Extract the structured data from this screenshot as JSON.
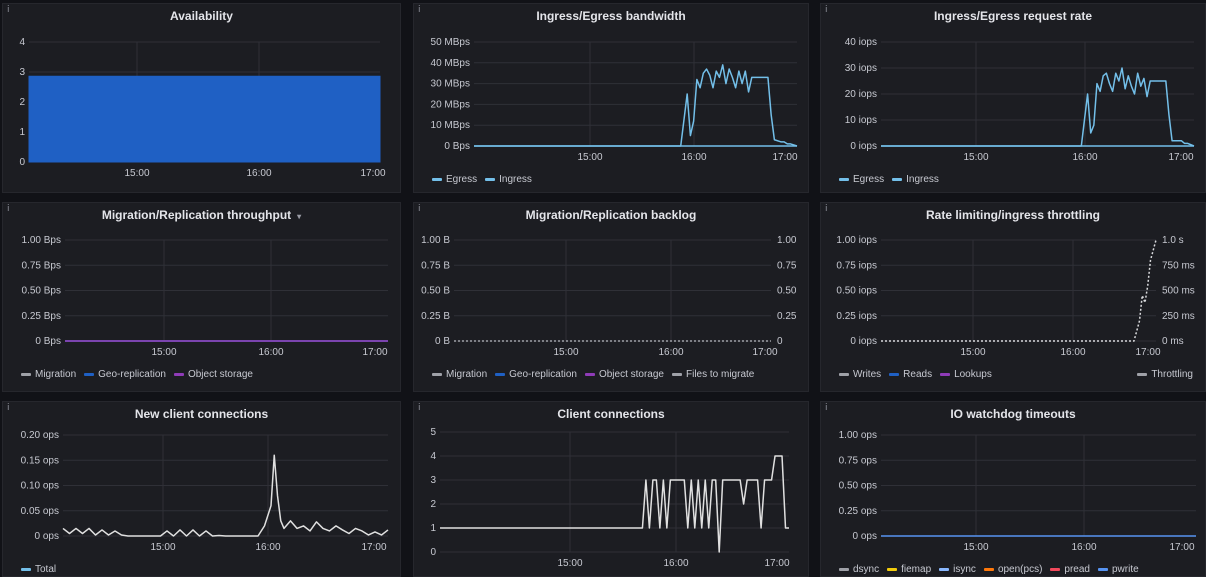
{
  "colors": {
    "background": "#111217",
    "panel": "#1c1d22",
    "grid": "#2f3037",
    "blue_area": "#1f60c4",
    "light_blue": "#73bfe9",
    "dark_blue": "#1f60c4",
    "purple": "#8f3bb8",
    "gray": "#9fa1a8",
    "white": "#e0e0e0",
    "yellow": "#f2cc0c",
    "cyan": "#8ab8ff",
    "orange": "#ff780a",
    "red": "#f2495c"
  },
  "panels": [
    {
      "title": "Availability",
      "chart_data": {
        "type": "area",
        "title": "Availability",
        "yticks": [
          "4",
          "3",
          "2",
          "1",
          "0"
        ],
        "ylim": [
          0,
          4.2
        ],
        "xticks": [
          "15:00",
          "16:00",
          "17:00"
        ],
        "series": [
          {
            "color": "#1f60c4",
            "x": [
              0,
              100
            ],
            "y": [
              3,
              3
            ]
          }
        ]
      }
    },
    {
      "title": "Ingress/Egress bandwidth",
      "legend": [
        {
          "label": "Egress",
          "color": "#73bfe9"
        },
        {
          "label": "Ingress",
          "color": "#73bfe9"
        }
      ],
      "chart_data": {
        "type": "line",
        "title": "Ingress/Egress bandwidth",
        "yticks": [
          "50 MBps",
          "40 MBps",
          "30 MBps",
          "20 MBps",
          "10 MBps",
          "0 Bps"
        ],
        "ylim": [
          0,
          50
        ],
        "xticks": [
          "15:00",
          "16:00",
          "17:00"
        ],
        "series": [
          {
            "name": "Egress",
            "color": "#73bfe9",
            "x": [
              0,
              100
            ],
            "y": [
              0,
              0
            ]
          },
          {
            "name": "Ingress",
            "color": "#73bfe9",
            "x": [
              0,
              64,
              66,
              67,
              68,
              69,
              70,
              71,
              72,
              73,
              74,
              75,
              76,
              77,
              78,
              79,
              80,
              81,
              82,
              83,
              84,
              85,
              86,
              87,
              88,
              89,
              90,
              91,
              92,
              93,
              95,
              96,
              97,
              98,
              100
            ],
            "y": [
              0,
              0,
              25,
              5,
              12,
              32,
              28,
              35,
              37,
              34,
              28,
              36,
              33,
              39,
              30,
              37,
              33,
              28,
              36,
              30,
              36,
              26,
              33,
              33,
              33,
              33,
              33,
              33,
              15,
              3,
              2,
              2,
              1,
              1,
              0
            ]
          }
        ]
      }
    },
    {
      "title": "Ingress/Egress request rate",
      "legend": [
        {
          "label": "Egress",
          "color": "#73bfe9"
        },
        {
          "label": "Ingress",
          "color": "#73bfe9"
        }
      ],
      "chart_data": {
        "type": "line",
        "title": "Ingress/Egress request rate",
        "yticks": [
          "40 iops",
          "30 iops",
          "20 iops",
          "10 iops",
          "0 iops"
        ],
        "ylim": [
          0,
          40
        ],
        "xticks": [
          "15:00",
          "16:00",
          "17:00"
        ],
        "series": [
          {
            "name": "Egress",
            "color": "#73bfe9",
            "x": [
              0,
              100
            ],
            "y": [
              0,
              0
            ]
          },
          {
            "name": "Ingress",
            "color": "#73bfe9",
            "x": [
              0,
              64,
              66,
              67,
              68,
              69,
              70,
              71,
              72,
              73,
              74,
              75,
              76,
              77,
              78,
              79,
              80,
              81,
              82,
              83,
              84,
              85,
              86,
              87,
              88,
              89,
              90,
              91,
              92,
              93,
              95,
              96,
              97,
              98,
              100
            ],
            "y": [
              0,
              0,
              20,
              5,
              8,
              24,
              21,
              27,
              28,
              24,
              21,
              28,
              25,
              30,
              22,
              27,
              23,
              20,
              28,
              23,
              26,
              19,
              25,
              25,
              25,
              25,
              25,
              25,
              12,
              2,
              2,
              2,
              1,
              1,
              0
            ]
          }
        ]
      }
    },
    {
      "title": "Migration/Replication throughput",
      "dropdown": "▾",
      "legend": [
        {
          "label": "Migration",
          "color": "#9fa1a8"
        },
        {
          "label": "Geo-replication",
          "color": "#1f60c4"
        },
        {
          "label": "Object storage",
          "color": "#8f3bb8"
        }
      ],
      "chart_data": {
        "type": "line",
        "title": "Migration/Replication throughput",
        "yticks": [
          "1.00 Bps",
          "0.75 Bps",
          "0.50 Bps",
          "0.25 Bps",
          "0 Bps"
        ],
        "ylim": [
          0,
          1
        ],
        "xticks": [
          "15:00",
          "16:00",
          "17:00"
        ],
        "series": [
          {
            "name": "Migration",
            "color": "#9fa1a8",
            "x": [
              0,
              100
            ],
            "y": [
              0,
              0
            ]
          },
          {
            "name": "Geo-replication",
            "color": "#1f60c4",
            "x": [
              0,
              100
            ],
            "y": [
              0,
              0
            ]
          },
          {
            "name": "Object storage",
            "color": "#8f3bb8",
            "x": [
              0,
              100
            ],
            "y": [
              0,
              0
            ]
          }
        ]
      }
    },
    {
      "title": "Migration/Replication backlog",
      "legend": [
        {
          "label": "Migration",
          "color": "#9fa1a8"
        },
        {
          "label": "Geo-replication",
          "color": "#1f60c4"
        },
        {
          "label": "Object storage",
          "color": "#8f3bb8"
        },
        {
          "label": "Files to migrate",
          "color": "#9fa1a8"
        }
      ],
      "chart_data": {
        "type": "line",
        "title": "Migration/Replication backlog",
        "yticks": [
          "1.00 B",
          "0.75 B",
          "0.50 B",
          "0.25 B",
          "0 B"
        ],
        "yticks_right": [
          "1.00",
          "0.75",
          "0.50",
          "0.25",
          "0"
        ],
        "ylim": [
          0,
          1
        ],
        "xticks": [
          "15:00",
          "16:00",
          "17:00"
        ],
        "series": [
          {
            "name": "Files to migrate",
            "color": "#9fa1a8",
            "dashed": true,
            "x": [
              0,
              100
            ],
            "y": [
              0,
              0
            ]
          }
        ]
      }
    },
    {
      "title": "Rate limiting/ingress throttling",
      "legend": [
        {
          "label": "Writes",
          "color": "#9fa1a8"
        },
        {
          "label": "Reads",
          "color": "#1f60c4"
        },
        {
          "label": "Lookups",
          "color": "#8f3bb8"
        }
      ],
      "legend_right": [
        {
          "label": "Throttling",
          "color": "#9fa1a8"
        }
      ],
      "chart_data": {
        "type": "line",
        "title": "Rate limiting/ingress throttling",
        "yticks": [
          "1.00 iops",
          "0.75 iops",
          "0.50 iops",
          "0.25 iops",
          "0 iops"
        ],
        "yticks_right": [
          "1.0 s",
          "750 ms",
          "500 ms",
          "250 ms",
          "0 ms"
        ],
        "ylim": [
          0,
          1
        ],
        "xticks": [
          "15:00",
          "16:00",
          "17:00"
        ],
        "series": [
          {
            "name": "Throttling",
            "color": "#d8d9dc",
            "dashed": true,
            "x": [
              0,
              92,
              94,
              95,
              96,
              97,
              98,
              100
            ],
            "y": [
              0,
              0,
              0.2,
              0.45,
              0.38,
              0.55,
              0.8,
              1.0
            ]
          }
        ]
      }
    },
    {
      "title": "New client connections",
      "legend": [
        {
          "label": "Total",
          "color": "#73bfe9"
        }
      ],
      "chart_data": {
        "type": "line",
        "title": "New client connections",
        "yticks": [
          "0.20 ops",
          "0.15 ops",
          "0.10 ops",
          "0.05 ops",
          "0 ops"
        ],
        "ylim": [
          0,
          0.2
        ],
        "xticks": [
          "15:00",
          "16:00",
          "17:00"
        ],
        "series": [
          {
            "name": "Total",
            "color": "#e0e0e0",
            "x": [
              0,
              2,
              4,
              6,
              8,
              10,
              12,
              14,
              16,
              18,
              20,
              30,
              32,
              34,
              36,
              38,
              40,
              42,
              44,
              46,
              48,
              50,
              60,
              62,
              64,
              65,
              66,
              67,
              68,
              70,
              72,
              74,
              76,
              78,
              80,
              82,
              84,
              86,
              88,
              90,
              92,
              94,
              96,
              98,
              100
            ],
            "y": [
              0.015,
              0.005,
              0.015,
              0.005,
              0.015,
              0.002,
              0.012,
              0.002,
              0.01,
              0.002,
              0,
              0,
              0.01,
              0,
              0.012,
              0,
              0.012,
              0,
              0.01,
              0,
              0.001,
              0,
              0,
              0.02,
              0.06,
              0.16,
              0.08,
              0.03,
              0.015,
              0.03,
              0.015,
              0.02,
              0.01,
              0.028,
              0.015,
              0.01,
              0.02,
              0.012,
              0.005,
              0.015,
              0.01,
              0.002,
              0.008,
              0.002,
              0.012
            ]
          }
        ]
      }
    },
    {
      "title": "Client connections",
      "chart_data": {
        "type": "line",
        "title": "Client connections",
        "yticks": [
          "5",
          "4",
          "3",
          "2",
          "1",
          "0"
        ],
        "ylim": [
          0,
          5
        ],
        "xticks": [
          "15:00",
          "16:00",
          "17:00"
        ],
        "series": [
          {
            "color": "#e0e0e0",
            "x": [
              0,
              58,
              59,
              60,
              61,
              62,
              63,
              64,
              65,
              66,
              67,
              68,
              69,
              70,
              71,
              72,
              73,
              74,
              75,
              76,
              77,
              78,
              79,
              80,
              81,
              82,
              83,
              84,
              85,
              86,
              87,
              88,
              89,
              90,
              91,
              92,
              93,
              94,
              95,
              96,
              97,
              98,
              99,
              100
            ],
            "y": [
              1,
              1,
              3,
              1,
              3,
              3,
              1,
              3,
              1,
              3,
              3,
              3,
              3,
              3,
              1,
              3,
              1,
              3,
              1,
              3,
              1,
              3,
              3,
              0,
              3,
              3,
              3,
              3,
              3,
              3,
              2,
              3,
              3,
              3,
              3,
              1,
              3,
              3,
              3,
              4,
              4,
              4,
              1,
              1
            ]
          }
        ]
      }
    },
    {
      "title": "IO watchdog timeouts",
      "legend": [
        {
          "label": "dsync",
          "color": "#9fa1a8"
        },
        {
          "label": "fiemap",
          "color": "#f2cc0c"
        },
        {
          "label": "isync",
          "color": "#8ab8ff"
        },
        {
          "label": "open(pcs)",
          "color": "#ff780a"
        },
        {
          "label": "pread",
          "color": "#f2495c"
        },
        {
          "label": "pwrite",
          "color": "#5794f2"
        }
      ],
      "chart_data": {
        "type": "line",
        "title": "IO watchdog timeouts",
        "yticks": [
          "1.00 ops",
          "0.75 ops",
          "0.50 ops",
          "0.25 ops",
          "0 ops"
        ],
        "ylim": [
          0,
          1
        ],
        "xticks": [
          "15:00",
          "16:00",
          "17:00"
        ],
        "series": [
          {
            "name": "pwrite",
            "color": "#5794f2",
            "x": [
              0,
              100
            ],
            "y": [
              0,
              0
            ]
          }
        ]
      }
    }
  ]
}
